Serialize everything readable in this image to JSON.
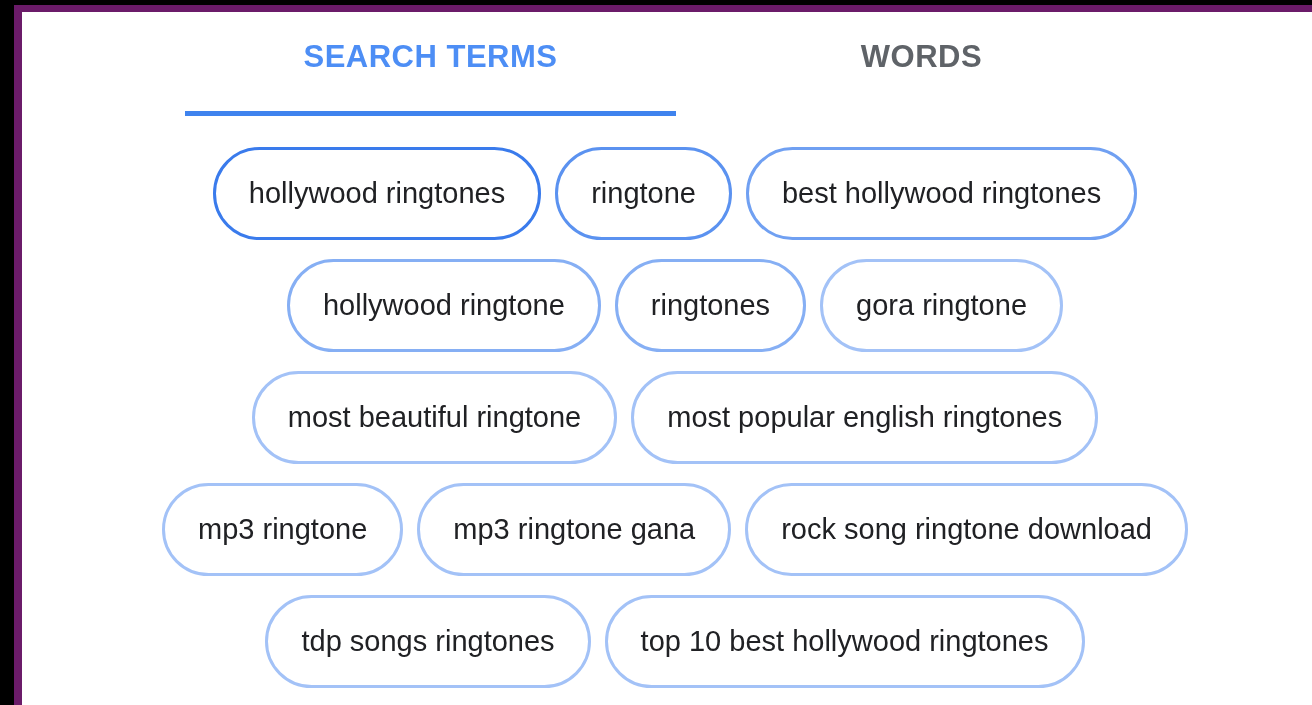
{
  "tabs": [
    {
      "label": "SEARCH TERMS",
      "selected": true
    },
    {
      "label": "WORDS",
      "selected": false
    }
  ],
  "chip_rows": [
    [
      {
        "text": "hollywood ringtones",
        "color": "#3a7bec"
      },
      {
        "text": "ringtone",
        "color": "#5b92f0"
      },
      {
        "text": "best hollywood ringtones",
        "color": "#70a0f2"
      }
    ],
    [
      {
        "text": "hollywood ringtone",
        "color": "#86aff4"
      },
      {
        "text": "ringtones",
        "color": "#86aff4"
      },
      {
        "text": "gora ringtone",
        "color": "#a3c2f7"
      }
    ],
    [
      {
        "text": "most beautiful ringtone",
        "color": "#a3c2f7"
      },
      {
        "text": "most popular english ringtones",
        "color": "#a3c2f7"
      }
    ],
    [
      {
        "text": "mp3 ringtone",
        "color": "#a3c2f7"
      },
      {
        "text": "mp3 ringtone gana",
        "color": "#a3c2f7"
      },
      {
        "text": "rock song ringtone download",
        "color": "#a3c2f7"
      }
    ],
    [
      {
        "text": "tdp songs ringtones",
        "color": "#a3c2f7"
      },
      {
        "text": "top 10 best hollywood ringtones",
        "color": "#a3c2f7"
      }
    ]
  ]
}
